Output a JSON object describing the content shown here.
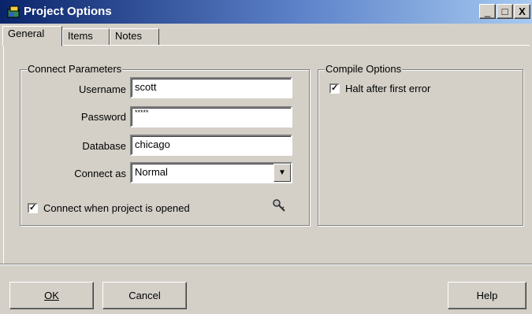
{
  "window": {
    "title": "Project Options",
    "icon": "project-app-icon",
    "controls": {
      "minimize": "_",
      "maximize": "□",
      "close": "X"
    }
  },
  "tabs": [
    {
      "label": "General",
      "active": true
    },
    {
      "label": "Items",
      "active": false
    },
    {
      "label": "Notes",
      "active": false
    }
  ],
  "connect": {
    "group_title": "Connect Parameters",
    "username_label": "Username",
    "username_value": "scott",
    "password_label": "Password",
    "password_value": "*****",
    "database_label": "Database",
    "database_value": "chicago",
    "connectas_label": "Connect as",
    "connectas_value": "Normal",
    "autoconnect_label": "Connect when project is opened",
    "autoconnect_checked": true,
    "test_icon": "key-icon"
  },
  "compile": {
    "group_title": "Compile Options",
    "halt_label": "Halt after first error",
    "halt_checked": true
  },
  "buttons": {
    "ok": "OK",
    "cancel": "Cancel",
    "help": "Help"
  }
}
